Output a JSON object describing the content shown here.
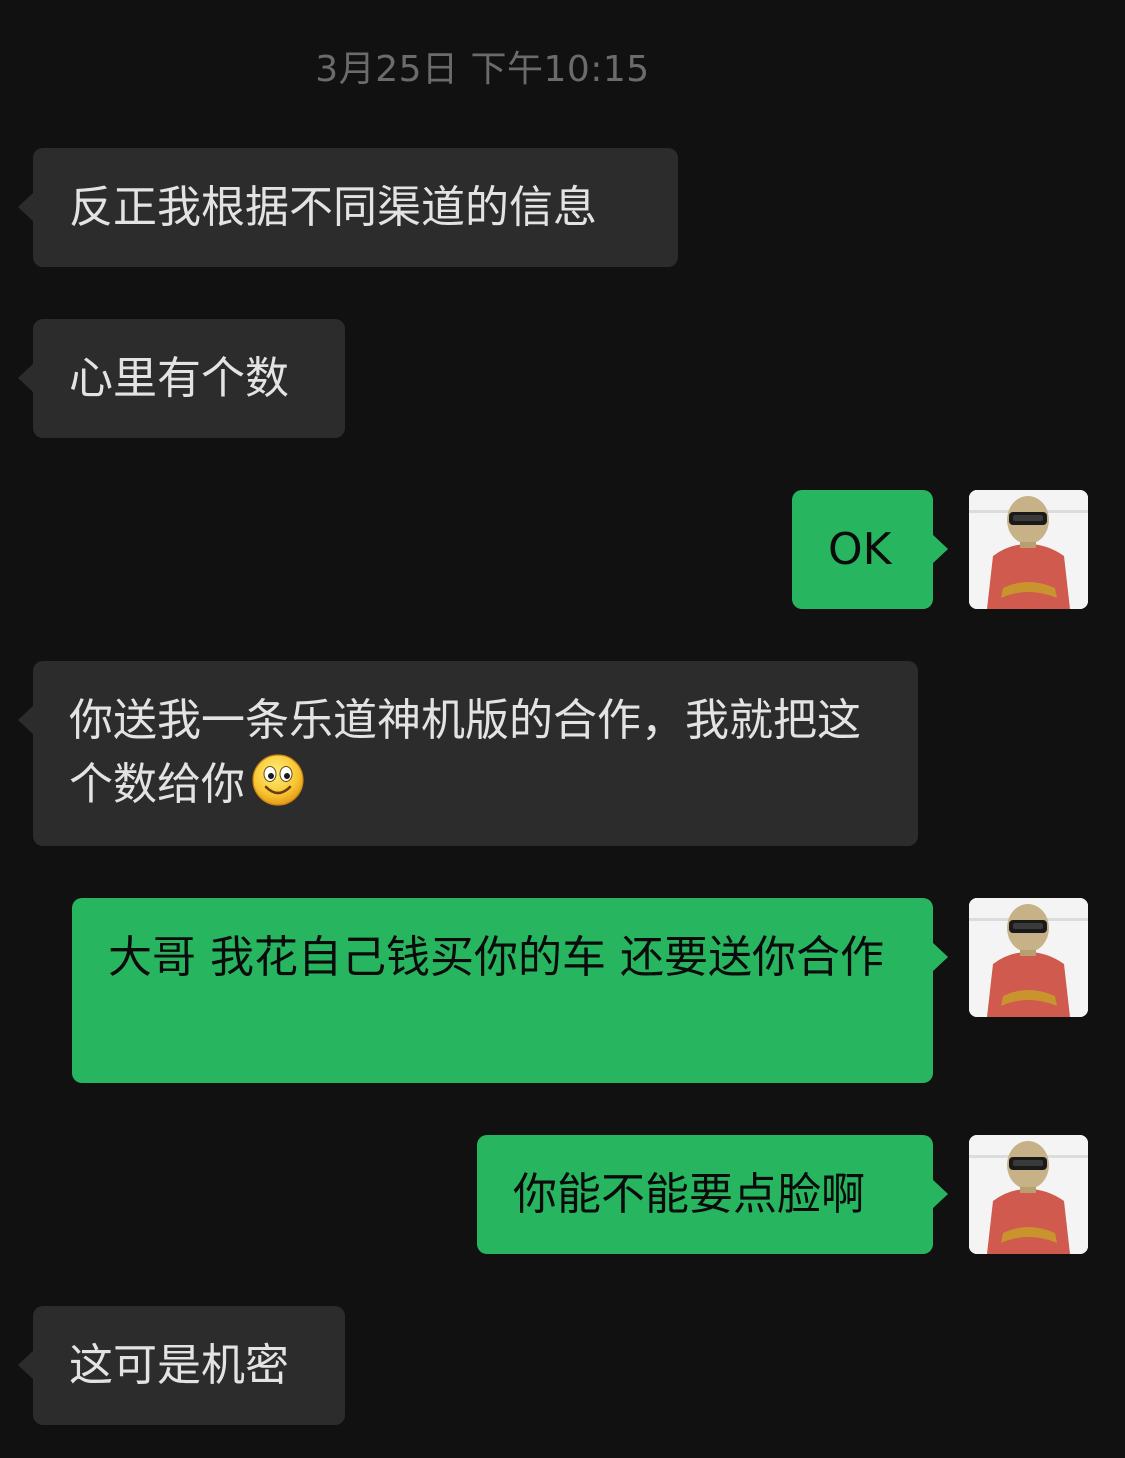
{
  "chat": {
    "timestamp": "3月25日 下午10:15",
    "messages": [
      {
        "from": "them",
        "text": "反正我根据不同渠道的信息"
      },
      {
        "from": "them",
        "text": "心里有个数"
      },
      {
        "from": "me",
        "text": "OK"
      },
      {
        "from": "them",
        "text": "你送我一条乐道神机版的合作，我就把这个数给你"
      },
      {
        "from": "me",
        "text": "大哥 我花自己钱买你的车 还要送你合作"
      },
      {
        "from": "me",
        "text": "你能不能要点脸啊"
      },
      {
        "from": "them",
        "text": "这可是机密"
      }
    ],
    "emoji_icon": "smiling-face-icon"
  },
  "colors": {
    "background": "#111111",
    "incoming_bubble": "#2c2c2c",
    "outgoing_bubble": "#28b560",
    "incoming_text": "#e3e3e3",
    "outgoing_text": "#0b0b0b",
    "timestamp_text": "#6b6b6b"
  }
}
